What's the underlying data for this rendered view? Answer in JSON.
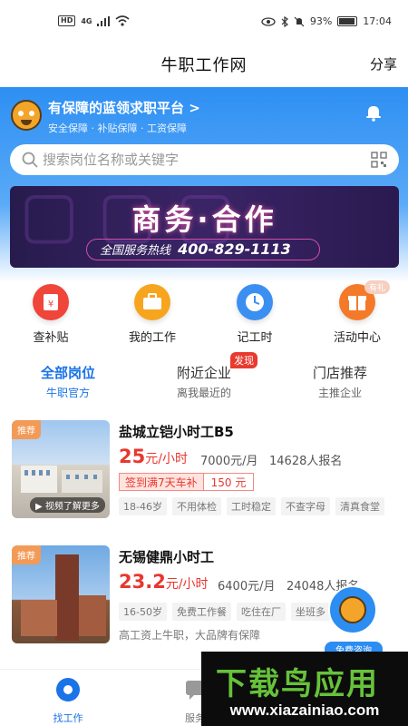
{
  "status_bar": {
    "network": "4G",
    "hd": "HD",
    "battery": "93%",
    "time": "17:04"
  },
  "header": {
    "title": "牛职工作网",
    "share_label": "分享"
  },
  "hero": {
    "title": "有保障的蓝领求职平台 >",
    "subtitle": "安全保障 · 补贴保障 · 工资保障"
  },
  "search": {
    "placeholder": "搜索岗位名称或关键字"
  },
  "banner": {
    "title": "商务·合作",
    "hotline_label": "全国服务热线",
    "hotline_number": "400-829-1113"
  },
  "quick_links": [
    {
      "label": "查补贴",
      "icon": "subsidy-icon",
      "color": "#f0453a"
    },
    {
      "label": "我的工作",
      "icon": "briefcase-icon",
      "color": "#f7a51e"
    },
    {
      "label": "记工时",
      "icon": "clock-icon",
      "color": "#3b8ff1"
    },
    {
      "label": "活动中心",
      "icon": "gift-icon",
      "color": "#f47a2a",
      "badge": "有礼"
    }
  ],
  "tabs": [
    {
      "label": "全部岗位",
      "sub": "牛职官方",
      "active": true
    },
    {
      "label": "附近企业",
      "sub": "离我最近的",
      "flag": "发现"
    },
    {
      "label": "门店推荐",
      "sub": "主推企业"
    }
  ],
  "jobs": [
    {
      "tag": "推荐",
      "video_label": "视频了解更多",
      "title": "盐城立铠小时工B5",
      "salary": "25",
      "salary_unit": "元/小时",
      "monthly": "7000元/月",
      "applicants": "14628人报名",
      "bonus_text": "签到满7天车补",
      "bonus_amount": "150 元",
      "chips": [
        "18-46岁",
        "不用体检",
        "工时稳定",
        "不查字母",
        "清真食堂"
      ]
    },
    {
      "tag": "推荐",
      "title": "无锡健鼎小时工",
      "salary": "23.2",
      "salary_unit": "元/小时",
      "monthly": "6400元/月",
      "applicants": "24048人报名",
      "chips": [
        "16-50岁",
        "免费工作餐",
        "吃住在厂",
        "坐班多"
      ],
      "desc": "高工资上牛职，大品牌有保障"
    }
  ],
  "float_chat": {
    "label": "免费咨询"
  },
  "bottom_nav": [
    {
      "label": "找工作",
      "active": true
    },
    {
      "label": "服务"
    }
  ],
  "watermark": {
    "brand": "下载鸟应用",
    "url": "www.xiazainiao.com"
  },
  "colors": {
    "primary": "#1a73e8",
    "hero": "#2d8ff3",
    "price": "#e8372f"
  }
}
